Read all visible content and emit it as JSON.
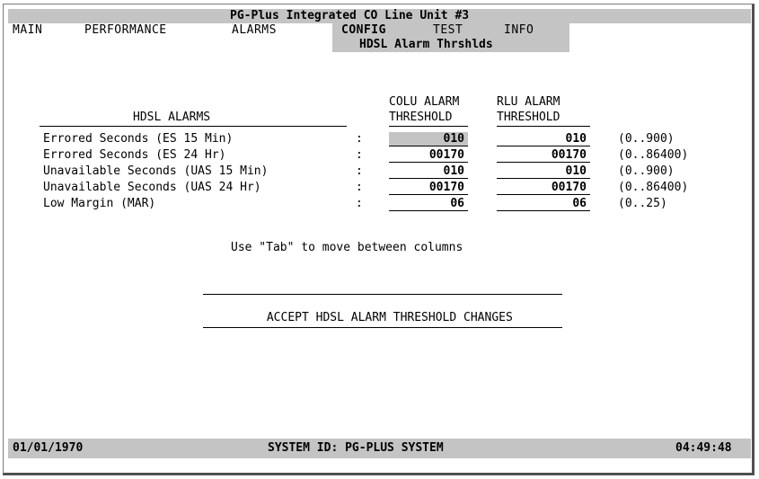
{
  "title": "PG-Plus Integrated CO Line Unit #3",
  "menu": {
    "main": "MAIN",
    "performance": "PERFORMANCE",
    "alarms": "ALARMS",
    "config": "CONFIG",
    "test": "TEST",
    "info": "INFO"
  },
  "screen_title": "HDSL Alarm Thrshlds",
  "columns": {
    "alarms_header": "HDSL ALARMS",
    "colu_line1": "COLU ALARM",
    "colu_line2": "THRESHOLD",
    "rlu_line1": "RLU ALARM",
    "rlu_line2": "THRESHOLD"
  },
  "rows": [
    {
      "label": "Errored Seconds (ES 15 Min)",
      "sep": ":",
      "colu": "010",
      "rlu": "010",
      "range": "(0..900)"
    },
    {
      "label": "Errored Seconds (ES 24 Hr)",
      "sep": ":",
      "colu": "00170",
      "rlu": "00170",
      "range": "(0..86400)"
    },
    {
      "label": "Unavailable Seconds (UAS 15 Min)",
      "sep": ":",
      "colu": "010",
      "rlu": "010",
      "range": "(0..900)"
    },
    {
      "label": "Unavailable Seconds (UAS 24 Hr)",
      "sep": ":",
      "colu": "00170",
      "rlu": "00170",
      "range": "(0..86400)"
    },
    {
      "label": "Low Margin (MAR)",
      "sep": ":",
      "colu": "06",
      "rlu": "06",
      "range": "(0..25)"
    }
  ],
  "hint": "Use \"Tab\" to move between columns",
  "accept_button": "ACCEPT HDSL ALARM THRESHOLD CHANGES",
  "status": {
    "date": "01/01/1970",
    "system_id": "SYSTEM ID: PG-PLUS SYSTEM",
    "time": "04:49:48"
  },
  "colors": {
    "bar": "#c4c4c4",
    "background": "#ffffff",
    "text": "#000000"
  }
}
